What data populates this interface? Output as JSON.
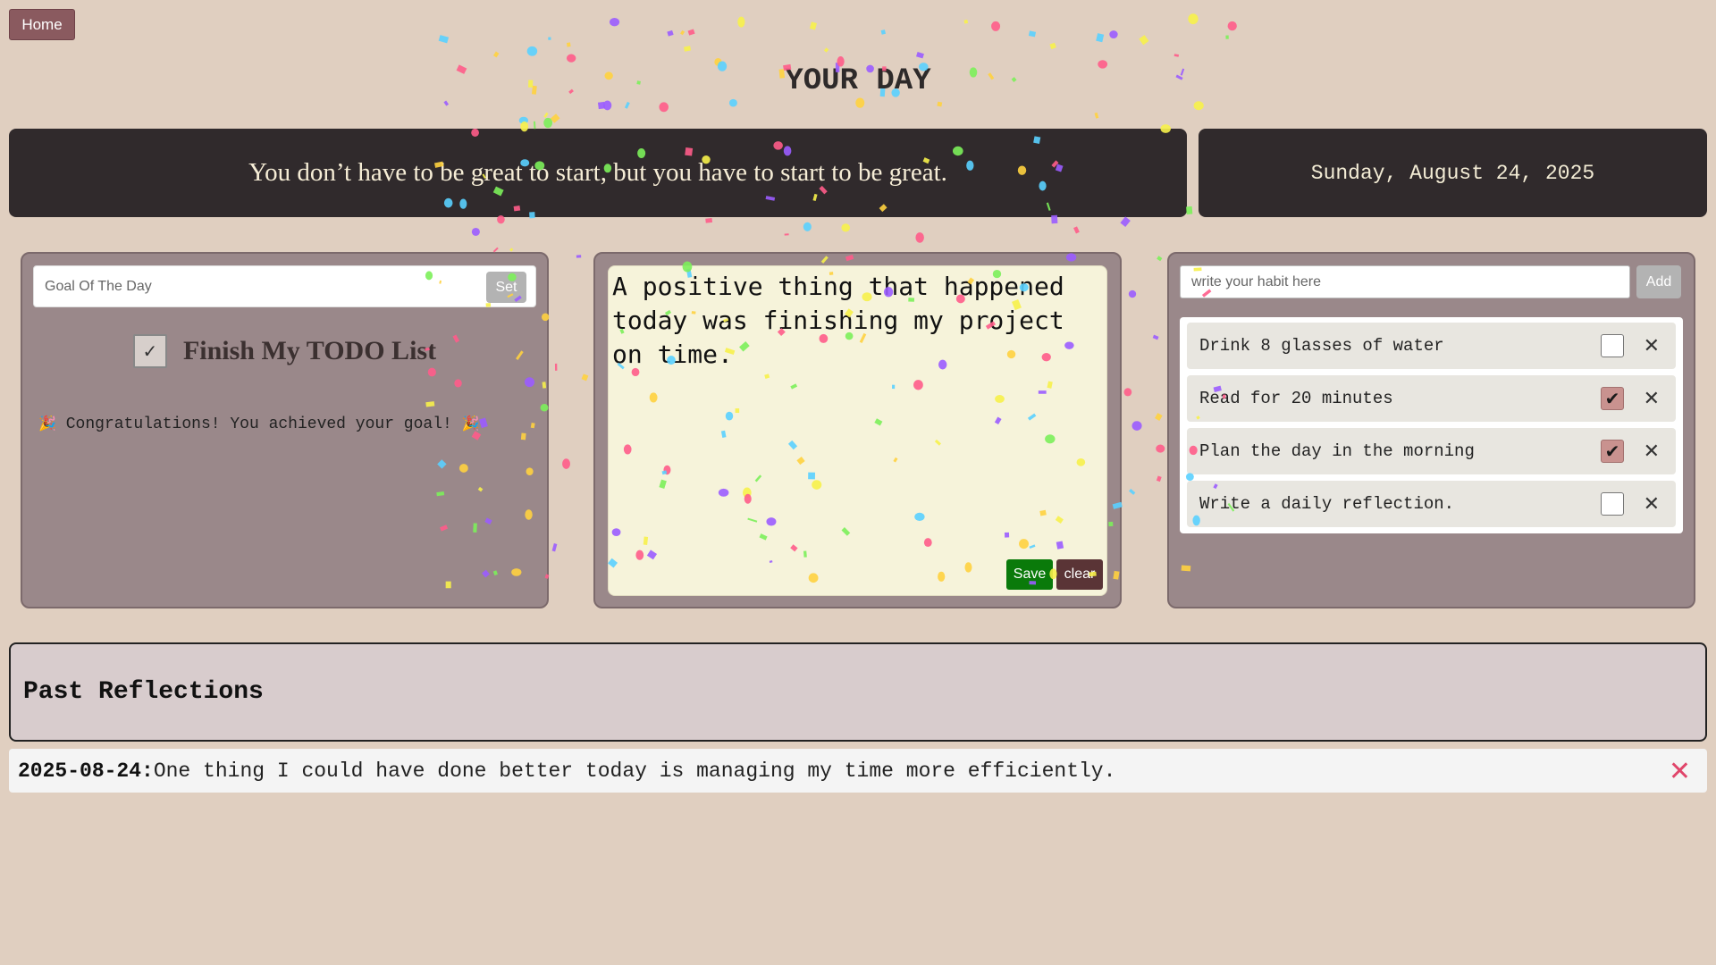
{
  "nav": {
    "home_label": "Home"
  },
  "page": {
    "title": "YOUR DAY"
  },
  "quote": {
    "text": "You don’t have to be great to start, but you have to start to be great."
  },
  "date": {
    "text": "Sunday, August 24, 2025"
  },
  "goal": {
    "placeholder": "Goal Of The Day",
    "set_label": "Set",
    "check_glyph": "✓",
    "text": "Finish My TODO List",
    "party_glyph": "🎉",
    "congrats": "Congratulations! You achieved your goal!"
  },
  "journal": {
    "text": "A positive thing that happened today was finishing my project on time.",
    "save_label": "Save",
    "clear_label": "clear"
  },
  "habits": {
    "placeholder": "write your habit here",
    "add_label": "Add",
    "check_glyph": "✔",
    "delete_glyph": "✕",
    "items": [
      {
        "label": "Drink 8 glasses of water",
        "done": false
      },
      {
        "label": "Read for 20 minutes",
        "done": true
      },
      {
        "label": "Plan the day in the morning",
        "done": true
      },
      {
        "label": "Write a daily reflection.",
        "done": false
      }
    ]
  },
  "past": {
    "title": "Past Reflections",
    "delete_glyph": "✕",
    "entries": [
      {
        "date": "2025-08-24:",
        "text": "One thing I could have done better today is managing my time more efficiently."
      }
    ]
  },
  "colors": {
    "background": "#e0cfc0",
    "dark_bar": "#302a2c",
    "panel": "#9a888a",
    "save": "#0a7a0a",
    "clear": "#5a3436",
    "delete_accent": "#e0456a",
    "confetti": [
      "#ff5c8a",
      "#f7f14a",
      "#5ad0ff",
      "#9b5cff",
      "#7cf05a",
      "#ffd23f"
    ]
  }
}
